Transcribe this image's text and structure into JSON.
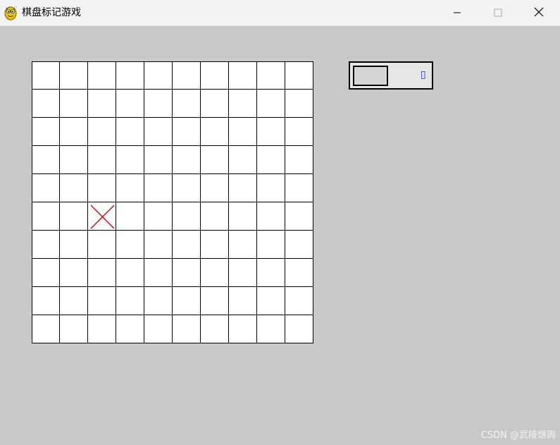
{
  "window": {
    "title": "棋盘标记游戏",
    "icon": "pygame-snake-icon",
    "buttons": [
      "minimize-icon",
      "maximize-icon",
      "close-icon"
    ]
  },
  "board": {
    "rows": 10,
    "cols": 10,
    "cell_color": "#ffffff",
    "grid_color": "#000000",
    "marks": [
      {
        "row": 6,
        "col": 3,
        "symbol": "X",
        "color": "#cc0000"
      }
    ]
  },
  "panel": {
    "glyph": "▯",
    "glyph_color": "#1a1aff"
  },
  "watermark": "CSDN @武陵惬舆"
}
